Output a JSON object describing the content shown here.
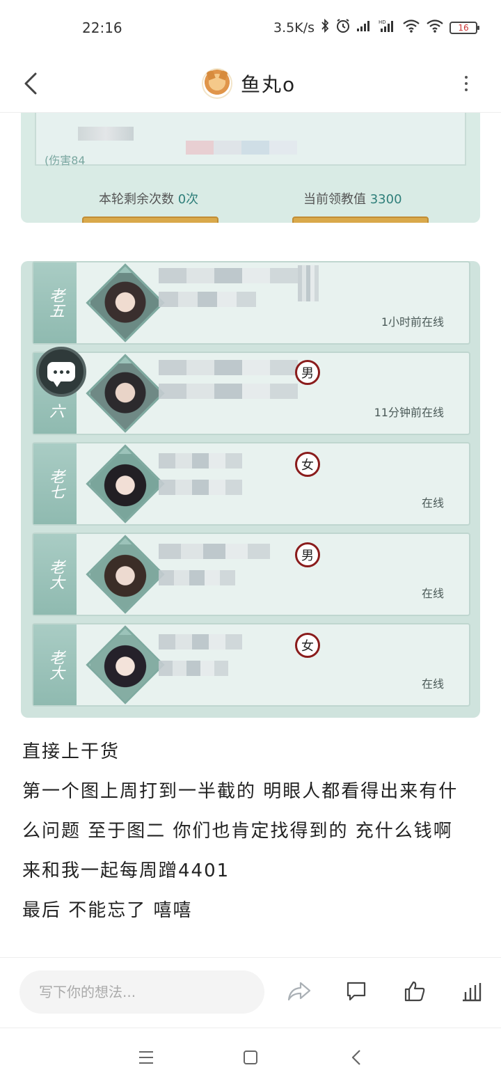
{
  "status_bar": {
    "time": "22:16",
    "net_speed": "3.5K/s",
    "battery": "16",
    "icons": [
      "bluetooth-icon",
      "alarm-icon",
      "signal-icon",
      "hd-signal-icon",
      "wifi-icon",
      "wifi-icon-2",
      "battery-icon"
    ]
  },
  "nav": {
    "title": "鱼丸o",
    "back_icon": "chevron-left-icon",
    "more_icon": "more-vertical-icon"
  },
  "image1": {
    "damage_label": "(伤害84",
    "remaining_label": "本轮剩余次数",
    "remaining_value": "0次",
    "teach_label": "当前领教值",
    "teach_value": "3300"
  },
  "image2": {
    "friends": [
      {
        "rank": "老五",
        "gender": "",
        "status": "1小时前在线"
      },
      {
        "rank": "六",
        "gender": "男",
        "status": "11分钟前在线"
      },
      {
        "rank": "老七",
        "gender": "女",
        "status": "在线"
      },
      {
        "rank": "老大",
        "gender": "男",
        "status": "在线"
      },
      {
        "rank": "老大",
        "gender": "女",
        "status": "在线"
      }
    ]
  },
  "post": {
    "lines": [
      "直接上干货",
      "第一个图上周打到一半截的 明眼人都看得出来有什",
      "么问题 至于图二 你们也肯定找得到的 充什么钱啊",
      "来和我一起每周蹭4401",
      "最后 不能忘了 嘻嘻"
    ]
  },
  "action_bar": {
    "comment_placeholder": "写下你的想法...",
    "icons": [
      "share-icon",
      "comment-icon",
      "like-icon",
      "stats-icon"
    ]
  },
  "system_nav": {
    "icons": [
      "menu-icon",
      "home-square-icon",
      "back-triangle-icon"
    ]
  }
}
